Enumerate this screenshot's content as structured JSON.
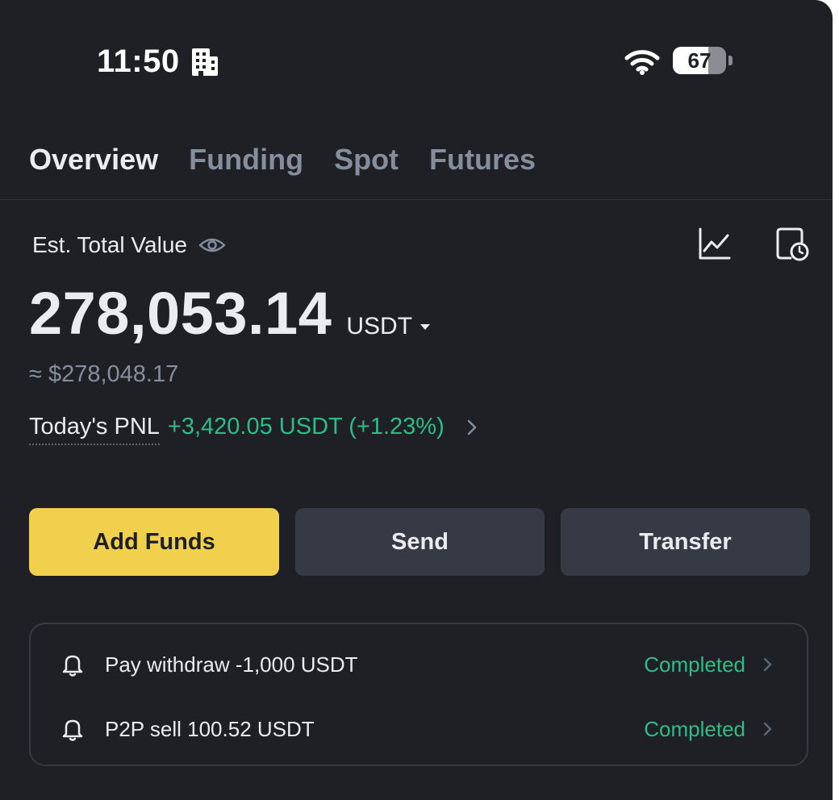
{
  "status_bar": {
    "time": "11:50",
    "battery_level": "67",
    "battery_fraction": 0.67
  },
  "tabs": [
    {
      "label": "Overview",
      "active": true
    },
    {
      "label": "Funding",
      "active": false
    },
    {
      "label": "Spot",
      "active": false
    },
    {
      "label": "Futures",
      "active": false
    }
  ],
  "balance": {
    "label": "Est. Total Value",
    "total": "278,053.14",
    "currency": "USDT",
    "approx": "≈ $278,048.17"
  },
  "pnl": {
    "label": "Today's PNL",
    "value": "+3,420.05 USDT (+1.23%)"
  },
  "actions": {
    "add_funds": "Add Funds",
    "send": "Send",
    "transfer": "Transfer"
  },
  "notifications": [
    {
      "text": "Pay withdraw -1,000 USDT",
      "status": "Completed"
    },
    {
      "text": "P2P sell 100.52 USDT",
      "status": "Completed"
    }
  ],
  "colors": {
    "background": "#1e2026",
    "primary_button": "#f0d04c",
    "secondary_button": "#353a45",
    "positive": "#2ebd85",
    "muted_text": "#848e9c"
  },
  "icons": [
    "building-icon",
    "wifi-icon",
    "battery-icon",
    "eye-icon",
    "chart-icon",
    "history-icon",
    "caret-down-icon",
    "chevron-right-icon",
    "bell-icon"
  ]
}
